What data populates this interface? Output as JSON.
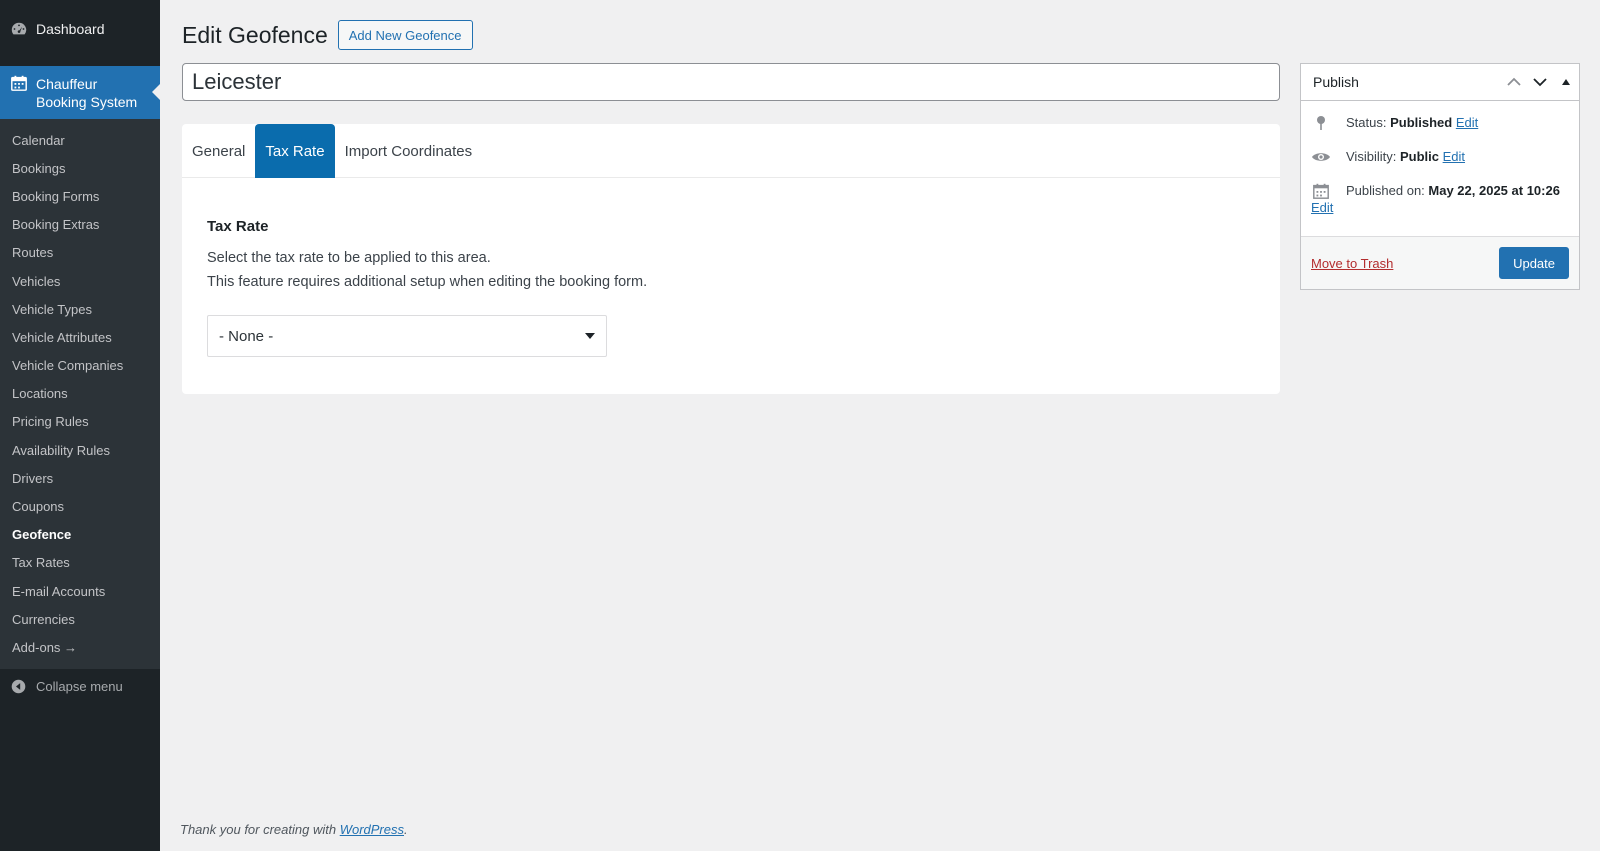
{
  "sidebar": {
    "dashboard_label": "Dashboard",
    "active_label": "Chauffeur Booking System",
    "items": [
      {
        "label": "Calendar"
      },
      {
        "label": "Bookings"
      },
      {
        "label": "Booking Forms"
      },
      {
        "label": "Booking Extras"
      },
      {
        "label": "Routes"
      },
      {
        "label": "Vehicles"
      },
      {
        "label": "Vehicle Types"
      },
      {
        "label": "Vehicle Attributes"
      },
      {
        "label": "Vehicle Companies"
      },
      {
        "label": "Locations"
      },
      {
        "label": "Pricing Rules"
      },
      {
        "label": "Availability Rules"
      },
      {
        "label": "Drivers"
      },
      {
        "label": "Coupons"
      },
      {
        "label": "Geofence"
      },
      {
        "label": "Tax Rates"
      },
      {
        "label": "E-mail Accounts"
      },
      {
        "label": "Currencies"
      },
      {
        "label": "Add-ons →"
      }
    ],
    "current_item": "Geofence",
    "collapse_label": "Collapse menu"
  },
  "header": {
    "title": "Edit Geofence",
    "add_new_label": "Add New Geofence"
  },
  "post": {
    "title_value": "Leicester"
  },
  "tabs": [
    {
      "label": "General"
    },
    {
      "label": "Tax Rate"
    },
    {
      "label": "Import Coordinates"
    }
  ],
  "active_tab": "Tax Rate",
  "tax_rate_section": {
    "heading": "Tax Rate",
    "description_line1": "Select the tax rate to be applied to this area.",
    "description_line2": "This feature requires additional setup when editing the booking form.",
    "select_value": "- None -"
  },
  "publish": {
    "title": "Publish",
    "status_label": "Status:",
    "status_value": "Published",
    "visibility_label": "Visibility:",
    "visibility_value": "Public",
    "published_on_label": "Published on:",
    "published_on_value": "May 22, 2025 at 10:26",
    "edit_label": "Edit",
    "trash_label": "Move to Trash",
    "update_label": "Update"
  },
  "footer": {
    "text": "Thank you for creating with",
    "link_label": "WordPress",
    "suffix": "."
  },
  "colors": {
    "accent": "#2271b1",
    "active_tab": "#0a6cad",
    "sidebar_bg": "#1d2327",
    "trash": "#b32d2e"
  }
}
